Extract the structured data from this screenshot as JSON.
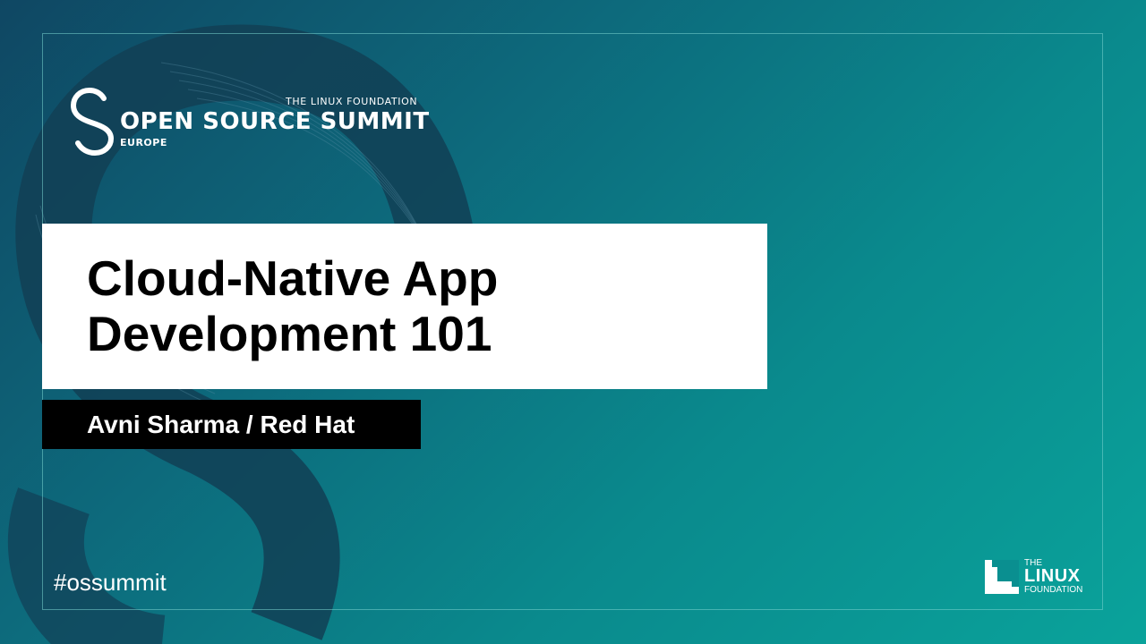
{
  "event": {
    "foundation": "THE LINUX FOUNDATION",
    "name": "OPEN SOURCE SUMMIT",
    "region": "EUROPE"
  },
  "talk": {
    "title": "Cloud-Native App Development 101",
    "speaker": "Avni Sharma / Red Hat"
  },
  "footer": {
    "hashtag": "#ossummit",
    "linux_foundation_logo": {
      "the": "THE",
      "linux": "LINUX",
      "foundation": "FOUNDATION"
    }
  },
  "colors": {
    "background_start": "#0f4763",
    "background_end": "#0aa39b",
    "title_box": "#ffffff",
    "speaker_box": "#000000",
    "text_light": "#ffffff"
  }
}
